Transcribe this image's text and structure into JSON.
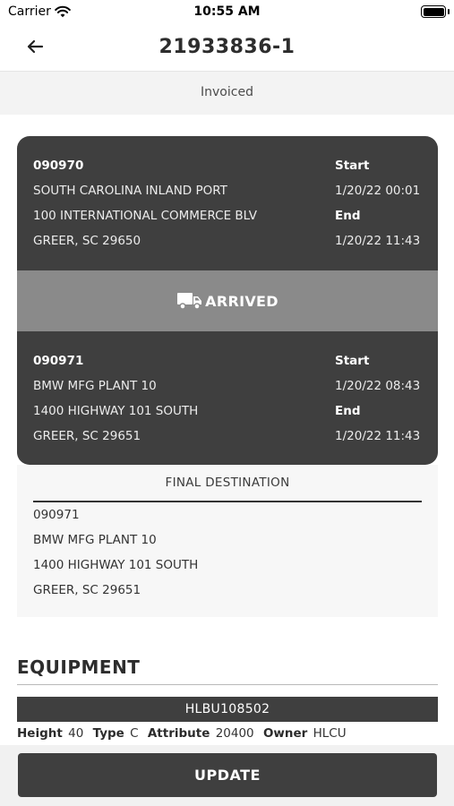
{
  "status_bar": {
    "carrier": "Carrier",
    "time": "10:55 AM",
    "icons": [
      "wifi-icon",
      "battery-icon"
    ]
  },
  "nav": {
    "back_icon": "arrow-left-icon",
    "title": "21933836-1"
  },
  "status": "Invoiced",
  "origin": {
    "code": "090970",
    "name": "SOUTH CAROLINA INLAND PORT",
    "address": "100 INTERNATIONAL COMMERCE BLV",
    "city": "GREER, SC 29650",
    "start_label": "Start",
    "start": "1/20/22 00:01",
    "end_label": "End",
    "end": "1/20/22 11:43"
  },
  "arrived": {
    "icon": "truck-icon",
    "label": "ARRIVED"
  },
  "destination": {
    "code": "090971",
    "name": "BMW MFG PLANT 10",
    "address": "1400 HIGHWAY 101 SOUTH",
    "city": "GREER, SC 29651",
    "start_label": "Start",
    "start": "1/20/22 08:43",
    "end_label": "End",
    "end": "1/20/22 11:43"
  },
  "final_destination": {
    "header": "FINAL DESTINATION",
    "code": "090971",
    "name": "BMW MFG PLANT 10",
    "address": "1400 HIGHWAY 101 SOUTH",
    "city": "GREER, SC 29651"
  },
  "equipment": {
    "title": "EQUIPMENT",
    "container": "HLBU108502",
    "attributes": [
      {
        "key": "Height",
        "value": "40"
      },
      {
        "key": "Type",
        "value": "C"
      },
      {
        "key": "Attribute",
        "value": "20400"
      },
      {
        "key": "Owner",
        "value": "HLCU"
      }
    ]
  },
  "footer": {
    "update_label": "UPDATE"
  },
  "colors": {
    "card": "#3f3f3f",
    "arrived_bar": "#8a8a8a",
    "status_strip": "#f3f3f3"
  }
}
